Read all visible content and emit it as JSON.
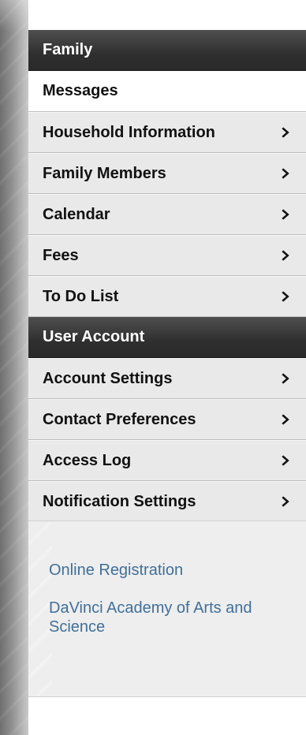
{
  "sections": [
    {
      "title": "Family",
      "items": [
        {
          "label": "Messages",
          "active": true,
          "has_chevron": false
        },
        {
          "label": "Household Information",
          "active": false,
          "has_chevron": true
        },
        {
          "label": "Family Members",
          "active": false,
          "has_chevron": true
        },
        {
          "label": "Calendar",
          "active": false,
          "has_chevron": true
        },
        {
          "label": "Fees",
          "active": false,
          "has_chevron": true
        },
        {
          "label": "To Do List",
          "active": false,
          "has_chevron": true
        }
      ]
    },
    {
      "title": "User Account",
      "items": [
        {
          "label": "Account Settings",
          "active": false,
          "has_chevron": true
        },
        {
          "label": "Contact Preferences",
          "active": false,
          "has_chevron": true
        },
        {
          "label": "Access Log",
          "active": false,
          "has_chevron": true
        },
        {
          "label": "Notification Settings",
          "active": false,
          "has_chevron": true
        }
      ]
    }
  ],
  "links": [
    {
      "label": "Online Registration"
    },
    {
      "label": "DaVinci Academy of Arts and Science"
    }
  ],
  "icons": {
    "chevron": "chevron-right-icon"
  },
  "colors": {
    "header_gradient_top": "#4f4f4f",
    "header_gradient_bottom": "#2a2a2a",
    "item_bg": "#e9e9e9",
    "active_item_bg": "#ffffff",
    "link_color": "#3f6f9a"
  }
}
